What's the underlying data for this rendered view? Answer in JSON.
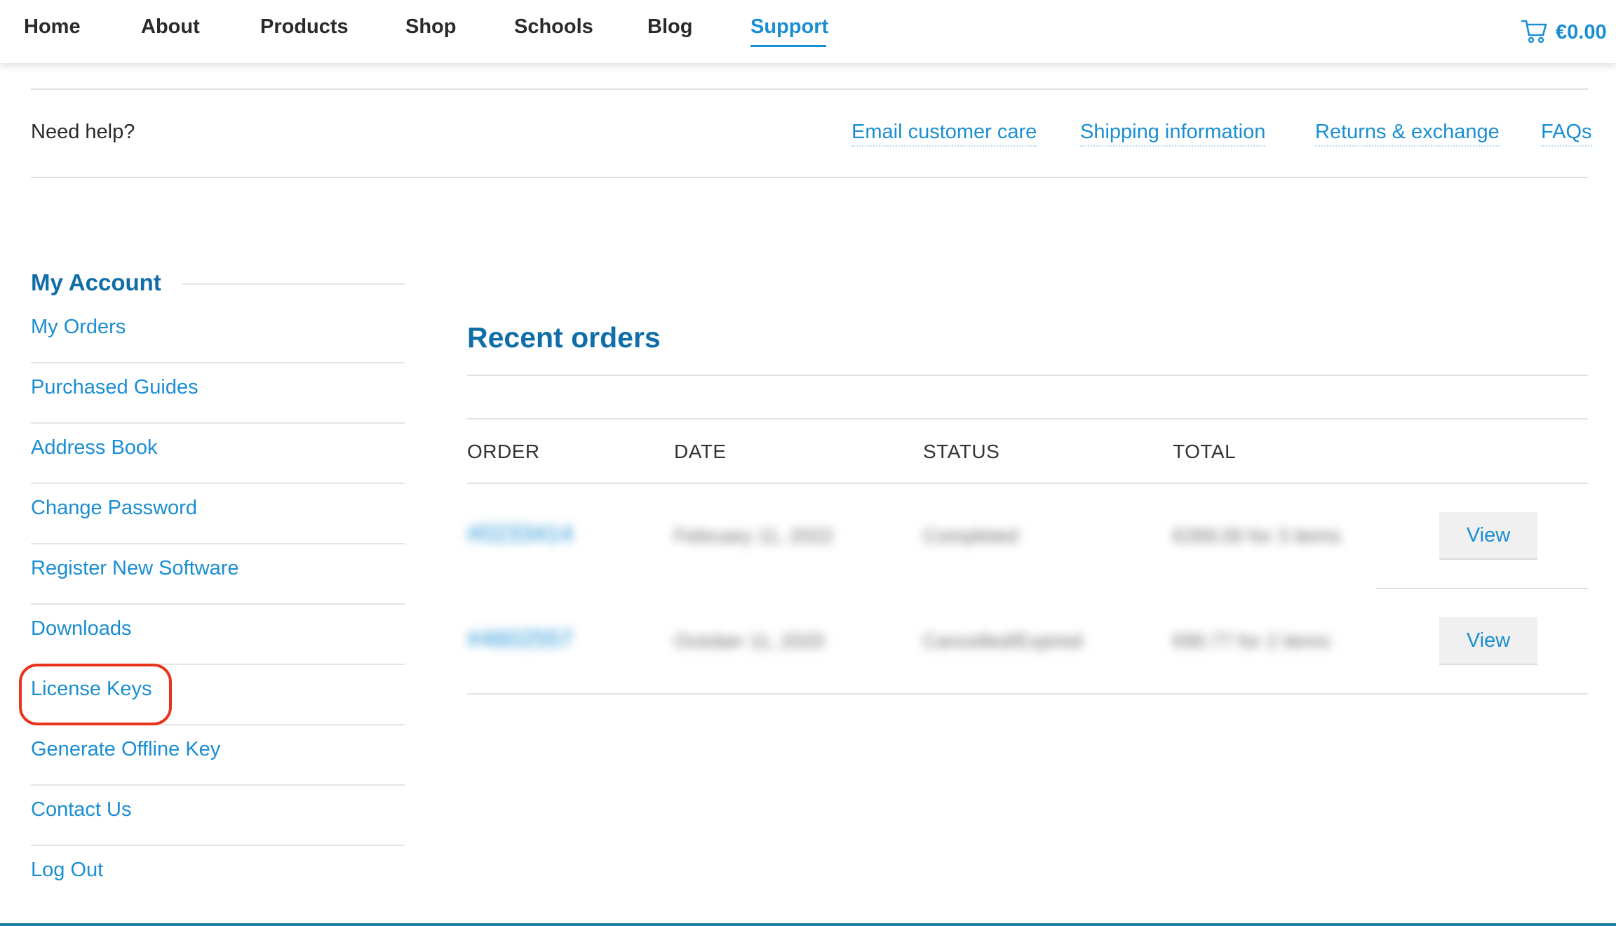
{
  "nav": {
    "items": [
      {
        "label": "Home"
      },
      {
        "label": "About"
      },
      {
        "label": "Products"
      },
      {
        "label": "Shop"
      },
      {
        "label": "Schools"
      },
      {
        "label": "Blog"
      },
      {
        "label": "Support",
        "active": true
      }
    ],
    "cart_total": "€0.00"
  },
  "help": {
    "label": "Need help?",
    "links": [
      {
        "label": "Email customer care"
      },
      {
        "label": "Shipping information"
      },
      {
        "label": "Returns & exchange"
      },
      {
        "label": "FAQs"
      }
    ]
  },
  "sidebar": {
    "heading": "My Account",
    "items": [
      {
        "label": "My Orders"
      },
      {
        "label": "Purchased Guides"
      },
      {
        "label": "Address Book"
      },
      {
        "label": "Change Password"
      },
      {
        "label": "Register New Software"
      },
      {
        "label": "Downloads"
      },
      {
        "label": "License Keys",
        "highlighted": true
      },
      {
        "label": "Generate Offline Key"
      },
      {
        "label": "Contact Us"
      },
      {
        "label": "Log Out"
      }
    ]
  },
  "orders": {
    "title": "Recent orders",
    "columns": [
      "ORDER",
      "DATE",
      "STATUS",
      "TOTAL"
    ],
    "rows": [
      {
        "order": "#0233414",
        "date": "February 11, 2022",
        "status": "Completed",
        "total": "€269.00 for 3 items",
        "action": "View"
      },
      {
        "order": "#4602557",
        "date": "October 11, 2020",
        "status": "Cancelled/Expired",
        "total": "€90.77 for 2 items",
        "action": "View"
      }
    ]
  },
  "colors": {
    "accent": "#1a8ed2",
    "heading": "#0f6ea8",
    "highlight": "#e8341c"
  }
}
